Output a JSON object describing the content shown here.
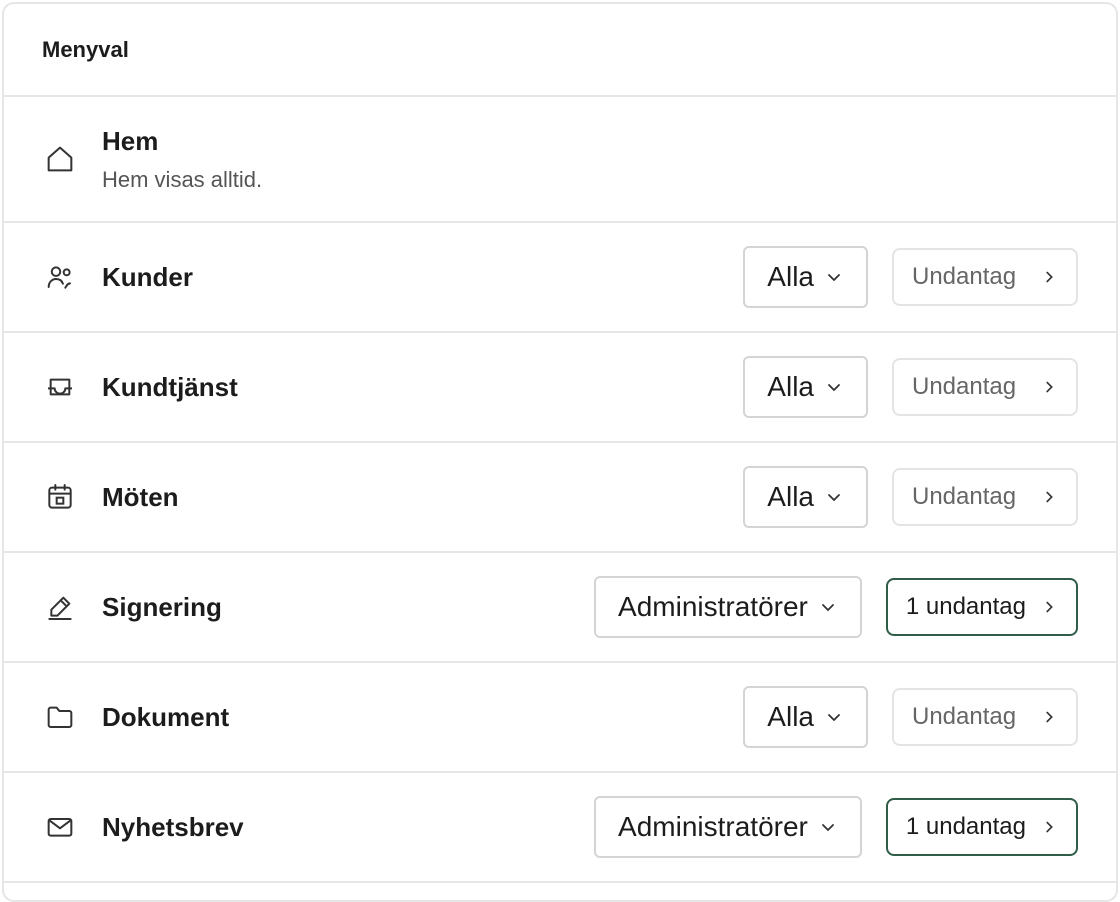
{
  "header": {
    "title": "Menyval"
  },
  "home": {
    "title": "Hem",
    "subtitle": "Hem visas alltid.",
    "icon": "home-icon"
  },
  "rows": [
    {
      "key": "kunder",
      "title": "Kunder",
      "icon": "users-icon",
      "access": "Alla",
      "exceptions": "Undantag",
      "has_exceptions": false
    },
    {
      "key": "kundtjanst",
      "title": "Kundtjänst",
      "icon": "inbox-icon",
      "access": "Alla",
      "exceptions": "Undantag",
      "has_exceptions": false
    },
    {
      "key": "moten",
      "title": "Möten",
      "icon": "calendar-icon",
      "access": "Alla",
      "exceptions": "Undantag",
      "has_exceptions": false
    },
    {
      "key": "signering",
      "title": "Signering",
      "icon": "pen-icon",
      "access": "Administratörer",
      "exceptions": "1 undantag",
      "has_exceptions": true
    },
    {
      "key": "dokument",
      "title": "Dokument",
      "icon": "folder-icon",
      "access": "Alla",
      "exceptions": "Undantag",
      "has_exceptions": false
    },
    {
      "key": "nyhetsbrev",
      "title": "Nyhetsbrev",
      "icon": "mail-icon",
      "access": "Administratörer",
      "exceptions": "1 undantag",
      "has_exceptions": true
    }
  ],
  "colors": {
    "accent": "#2f5d48",
    "border": "#e6e6e6",
    "text": "#1c1c1c",
    "muted": "#666666"
  }
}
